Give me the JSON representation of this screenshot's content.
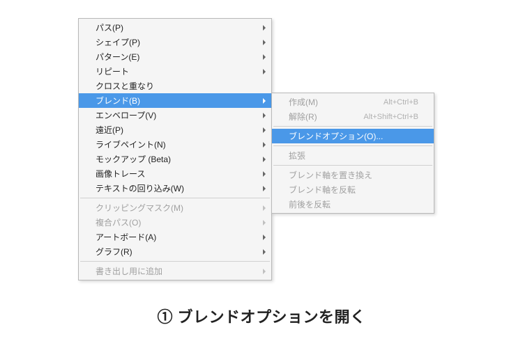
{
  "mainMenu": {
    "groups": [
      [
        {
          "label": "パス(P)",
          "hasSub": true
        },
        {
          "label": "シェイプ(P)",
          "hasSub": true
        },
        {
          "label": "パターン(E)",
          "hasSub": true
        },
        {
          "label": "リピート",
          "hasSub": true
        },
        {
          "label": "クロスと重なり",
          "hasSub": false
        },
        {
          "label": "ブレンド(B)",
          "hasSub": true,
          "highlight": true
        },
        {
          "label": "エンベロープ(V)",
          "hasSub": true
        },
        {
          "label": "遠近(P)",
          "hasSub": true
        },
        {
          "label": "ライブペイント(N)",
          "hasSub": true
        },
        {
          "label": "モックアップ (Beta)",
          "hasSub": true
        },
        {
          "label": "画像トレース",
          "hasSub": true
        },
        {
          "label": "テキストの回り込み(W)",
          "hasSub": true
        }
      ],
      [
        {
          "label": "クリッピングマスク(M)",
          "hasSub": true,
          "disabled": true
        },
        {
          "label": "複合パス(O)",
          "hasSub": true,
          "disabled": true
        },
        {
          "label": "アートボード(A)",
          "hasSub": true
        },
        {
          "label": "グラフ(R)",
          "hasSub": true
        }
      ],
      [
        {
          "label": "書き出し用に追加",
          "hasSub": true,
          "disabled": true
        }
      ]
    ]
  },
  "subMenu": {
    "groups": [
      [
        {
          "label": "作成(M)",
          "shortcut": "Alt+Ctrl+B",
          "disabled": true
        },
        {
          "label": "解除(R)",
          "shortcut": "Alt+Shift+Ctrl+B",
          "disabled": true
        }
      ],
      [
        {
          "label": "ブレンドオプション(O)...",
          "highlight": true
        }
      ],
      [
        {
          "label": "拡張",
          "disabled": true
        }
      ],
      [
        {
          "label": "ブレンド軸を置き換え",
          "disabled": true
        },
        {
          "label": "ブレンド軸を反転",
          "disabled": true
        },
        {
          "label": "前後を反転",
          "disabled": true
        }
      ]
    ]
  },
  "caption": "① ブレンドオプションを開く"
}
